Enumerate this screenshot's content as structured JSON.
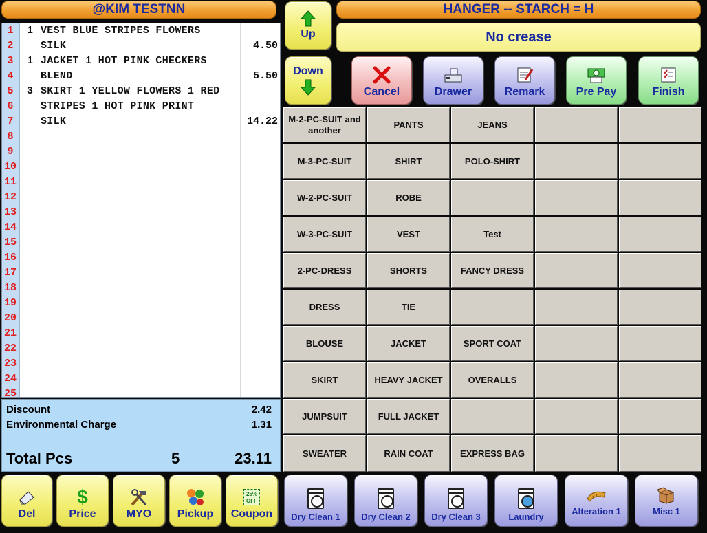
{
  "customer": {
    "name": "@KIM TESTNN"
  },
  "hanger": {
    "title": "HANGER -- STARCH = H",
    "status": "No crease"
  },
  "nav": {
    "up_label": "Up",
    "down_label": "Down"
  },
  "actions": {
    "cancel": "Cancel",
    "drawer": "Drawer",
    "remark": "Remark",
    "prepay": "Pre Pay",
    "finish": "Finish"
  },
  "ticket": {
    "rows": [
      {
        "num": "1",
        "qty": "1",
        "desc": "VEST BLUE STRIPES FLOWERS",
        "price": ""
      },
      {
        "num": "2",
        "qty": "",
        "desc": "SILK",
        "price": "4.50"
      },
      {
        "num": "3",
        "qty": "1",
        "desc": "JACKET 1 HOT PINK CHECKERS",
        "price": ""
      },
      {
        "num": "4",
        "qty": "",
        "desc": "BLEND",
        "price": "5.50"
      },
      {
        "num": "5",
        "qty": "3",
        "desc": "SKIRT 1 YELLOW FLOWERS 1 RED",
        "price": ""
      },
      {
        "num": "6",
        "qty": "",
        "desc": "STRIPES 1 HOT PINK PRINT",
        "price": ""
      },
      {
        "num": "7",
        "qty": "",
        "desc": "SILK",
        "price": "14.22"
      },
      {
        "num": "8",
        "qty": "",
        "desc": "",
        "price": ""
      },
      {
        "num": "9",
        "qty": "",
        "desc": "",
        "price": ""
      },
      {
        "num": "10",
        "qty": "",
        "desc": "",
        "price": ""
      },
      {
        "num": "11",
        "qty": "",
        "desc": "",
        "price": ""
      },
      {
        "num": "12",
        "qty": "",
        "desc": "",
        "price": ""
      },
      {
        "num": "13",
        "qty": "",
        "desc": "",
        "price": ""
      },
      {
        "num": "14",
        "qty": "",
        "desc": "",
        "price": ""
      },
      {
        "num": "15",
        "qty": "",
        "desc": "",
        "price": ""
      },
      {
        "num": "16",
        "qty": "",
        "desc": "",
        "price": ""
      },
      {
        "num": "17",
        "qty": "",
        "desc": "",
        "price": ""
      },
      {
        "num": "18",
        "qty": "",
        "desc": "",
        "price": ""
      },
      {
        "num": "19",
        "qty": "",
        "desc": "",
        "price": ""
      },
      {
        "num": "20",
        "qty": "",
        "desc": "",
        "price": ""
      },
      {
        "num": "21",
        "qty": "",
        "desc": "",
        "price": ""
      },
      {
        "num": "22",
        "qty": "",
        "desc": "",
        "price": ""
      },
      {
        "num": "23",
        "qty": "",
        "desc": "",
        "price": ""
      },
      {
        "num": "24",
        "qty": "",
        "desc": "",
        "price": ""
      },
      {
        "num": "25",
        "qty": "",
        "desc": "",
        "price": ""
      }
    ]
  },
  "summary": {
    "discount_label": "Discount",
    "discount_value": "2.42",
    "env_label": "Environmental Charge",
    "env_value": "1.31",
    "total_label": "Total Pcs",
    "total_pcs": "5",
    "total_amount": "23.11"
  },
  "items": [
    [
      "M-2-PC-SUIT and another",
      "PANTS",
      "JEANS",
      "",
      ""
    ],
    [
      "M-3-PC-SUIT",
      "SHIRT",
      "POLO-SHIRT",
      "",
      ""
    ],
    [
      "W-2-PC-SUIT",
      "ROBE",
      "",
      "",
      ""
    ],
    [
      "W-3-PC-SUIT",
      "VEST",
      "Test",
      "",
      ""
    ],
    [
      "2-PC-DRESS",
      "SHORTS",
      "FANCY DRESS",
      "",
      ""
    ],
    [
      "DRESS",
      "TIE",
      "",
      "",
      ""
    ],
    [
      "BLOUSE",
      "JACKET",
      "SPORT COAT",
      "",
      ""
    ],
    [
      "SKIRT",
      "HEAVY JACKET",
      "OVERALLS",
      "",
      ""
    ],
    [
      "JUMPSUIT",
      "FULL JACKET",
      "",
      "",
      ""
    ],
    [
      "SWEATER",
      "RAIN COAT",
      "EXPRESS BAG",
      "",
      ""
    ]
  ],
  "bottom_left": {
    "del": "Del",
    "price": "Price",
    "myo": "MYO",
    "pickup": "Pickup",
    "coupon": "Coupon",
    "coupon_badge": "25% OFF"
  },
  "categories": {
    "dry1": "Dry Clean 1",
    "dry2": "Dry Clean 2",
    "dry3": "Dry Clean 3",
    "laundry": "Laundry",
    "alteration": "Alteration 1",
    "misc": "Misc 1"
  },
  "colors": {
    "header_orange": "#f0a030",
    "label_blue": "#1a2aa0",
    "line_number_red": "#e02020",
    "summary_blue": "#b4dcf8",
    "grid_gray": "#d4d0c8"
  }
}
